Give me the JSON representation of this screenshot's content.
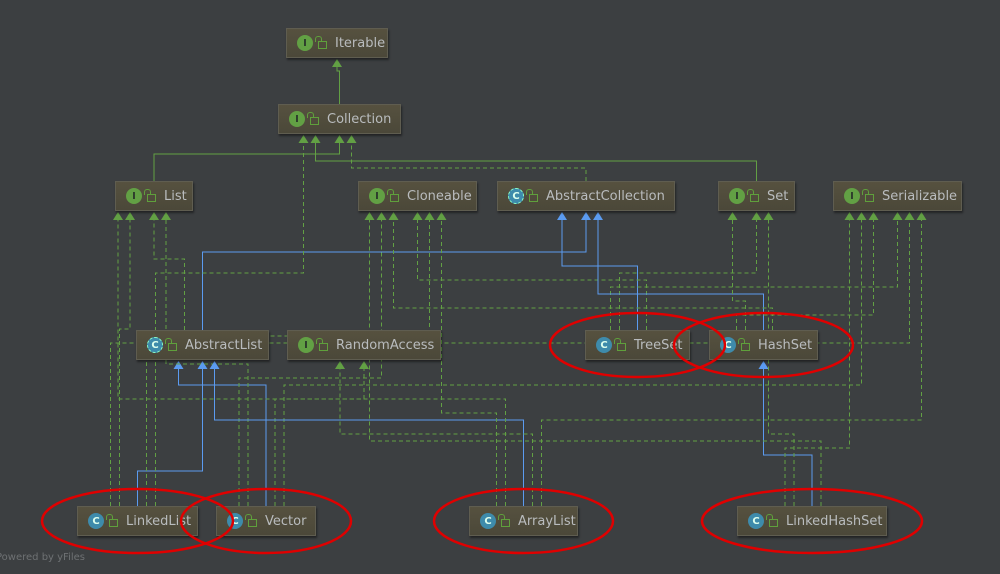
{
  "nodes": [
    {
      "id": "Iterable",
      "label": "Iterable",
      "kind": "interface"
    },
    {
      "id": "Collection",
      "label": "Collection",
      "kind": "interface"
    },
    {
      "id": "List",
      "label": "List",
      "kind": "interface"
    },
    {
      "id": "Cloneable",
      "label": "Cloneable",
      "kind": "interface"
    },
    {
      "id": "AbstractCollection",
      "label": "AbstractCollection",
      "kind": "abstract-class"
    },
    {
      "id": "Set",
      "label": "Set",
      "kind": "interface"
    },
    {
      "id": "Serializable",
      "label": "Serializable",
      "kind": "interface"
    },
    {
      "id": "AbstractList",
      "label": "AbstractList",
      "kind": "abstract-class"
    },
    {
      "id": "RandomAccess",
      "label": "RandomAccess",
      "kind": "interface"
    },
    {
      "id": "TreeSet",
      "label": "TreeSet",
      "kind": "class",
      "highlighted": true
    },
    {
      "id": "HashSet",
      "label": "HashSet",
      "kind": "class",
      "highlighted": true
    },
    {
      "id": "LinkedList",
      "label": "LinkedList",
      "kind": "class",
      "highlighted": true
    },
    {
      "id": "Vector",
      "label": "Vector",
      "kind": "class",
      "highlighted": true
    },
    {
      "id": "ArrayList",
      "label": "ArrayList",
      "kind": "class",
      "highlighted": true
    },
    {
      "id": "LinkedHashSet",
      "label": "LinkedHashSet",
      "kind": "class",
      "highlighted": true
    }
  ],
  "badge_letters": {
    "interface": "I",
    "class": "C",
    "abstract-class": "C"
  },
  "edges": [
    {
      "from": "Collection",
      "to": "Iterable",
      "type": "extends-interface"
    },
    {
      "from": "List",
      "to": "Collection",
      "type": "extends-interface"
    },
    {
      "from": "Set",
      "to": "Collection",
      "type": "extends-interface"
    },
    {
      "from": "AbstractCollection",
      "to": "Collection",
      "type": "implements"
    },
    {
      "from": "AbstractList",
      "to": "AbstractCollection",
      "type": "extends-class"
    },
    {
      "from": "AbstractList",
      "to": "List",
      "type": "implements"
    },
    {
      "from": "TreeSet",
      "to": "AbstractCollection",
      "type": "extends-class"
    },
    {
      "from": "TreeSet",
      "to": "Set",
      "type": "implements"
    },
    {
      "from": "TreeSet",
      "to": "Cloneable",
      "type": "implements"
    },
    {
      "from": "TreeSet",
      "to": "Serializable",
      "type": "implements"
    },
    {
      "from": "HashSet",
      "to": "AbstractCollection",
      "type": "extends-class"
    },
    {
      "from": "HashSet",
      "to": "Set",
      "type": "implements"
    },
    {
      "from": "HashSet",
      "to": "Cloneable",
      "type": "implements"
    },
    {
      "from": "HashSet",
      "to": "Serializable",
      "type": "implements"
    },
    {
      "from": "LinkedList",
      "to": "AbstractList",
      "type": "extends-class"
    },
    {
      "from": "LinkedList",
      "to": "List",
      "type": "implements"
    },
    {
      "from": "LinkedList",
      "to": "Cloneable",
      "type": "implements"
    },
    {
      "from": "LinkedList",
      "to": "Serializable",
      "type": "implements"
    },
    {
      "from": "LinkedList",
      "to": "Collection",
      "type": "implements"
    },
    {
      "from": "Vector",
      "to": "AbstractList",
      "type": "extends-class"
    },
    {
      "from": "Vector",
      "to": "List",
      "type": "implements"
    },
    {
      "from": "Vector",
      "to": "RandomAccess",
      "type": "implements"
    },
    {
      "from": "Vector",
      "to": "Cloneable",
      "type": "implements"
    },
    {
      "from": "Vector",
      "to": "Serializable",
      "type": "implements"
    },
    {
      "from": "ArrayList",
      "to": "AbstractList",
      "type": "extends-class"
    },
    {
      "from": "ArrayList",
      "to": "List",
      "type": "implements"
    },
    {
      "from": "ArrayList",
      "to": "RandomAccess",
      "type": "implements"
    },
    {
      "from": "ArrayList",
      "to": "Cloneable",
      "type": "implements"
    },
    {
      "from": "ArrayList",
      "to": "Serializable",
      "type": "implements"
    },
    {
      "from": "LinkedHashSet",
      "to": "HashSet",
      "type": "extends-class"
    },
    {
      "from": "LinkedHashSet",
      "to": "Set",
      "type": "implements"
    },
    {
      "from": "LinkedHashSet",
      "to": "Cloneable",
      "type": "implements"
    },
    {
      "from": "LinkedHashSet",
      "to": "Serializable",
      "type": "implements"
    }
  ],
  "colors": {
    "background": "#3c3f41",
    "interface_edge": "#62a044",
    "class_edge": "#5b9bf0",
    "highlight": "#e00000"
  },
  "footer": "Powered by yFiles"
}
